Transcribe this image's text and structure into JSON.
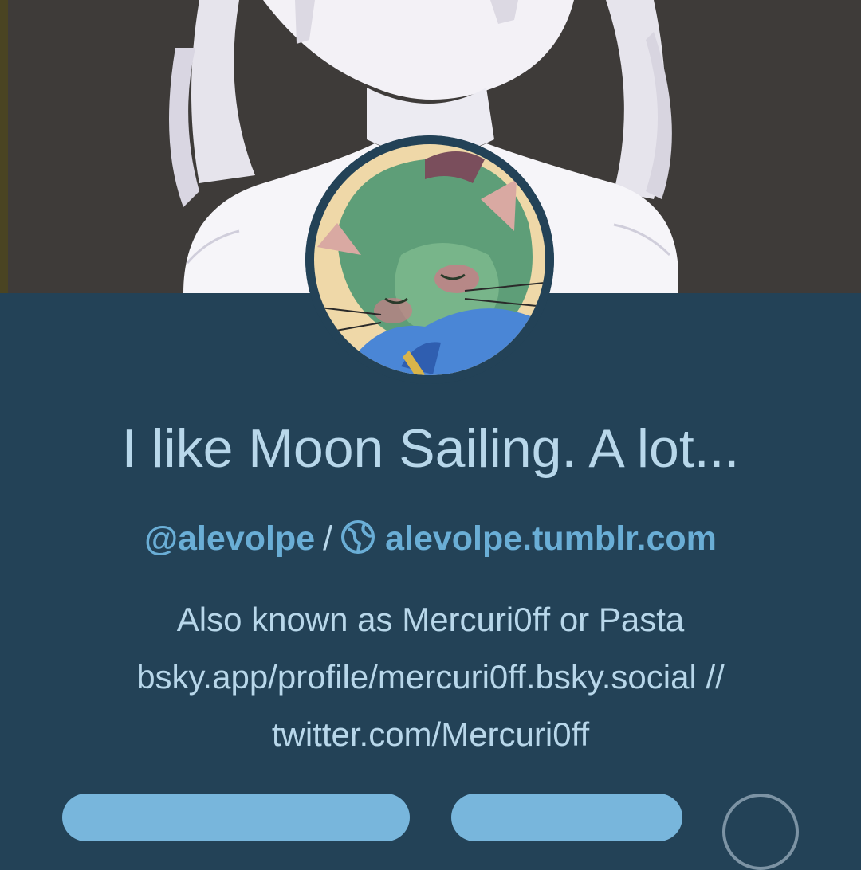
{
  "profile": {
    "title": "I like Moon Sailing. A lot...",
    "handle": "@alevolpe",
    "separator": "/",
    "website": "alevolpe.tumblr.com",
    "website_icon": "globe-icon",
    "bio_lines": [
      "Also known as Mercuri0ff or Pasta",
      "bsky.app/profile/mercuri0ff.bsky.social //",
      "twitter.com/Mercuri0ff"
    ]
  },
  "colors": {
    "panel_bg": "#234257",
    "title_text": "#b8d7ea",
    "link": "#6aaed6",
    "button": "#78b6dc"
  }
}
